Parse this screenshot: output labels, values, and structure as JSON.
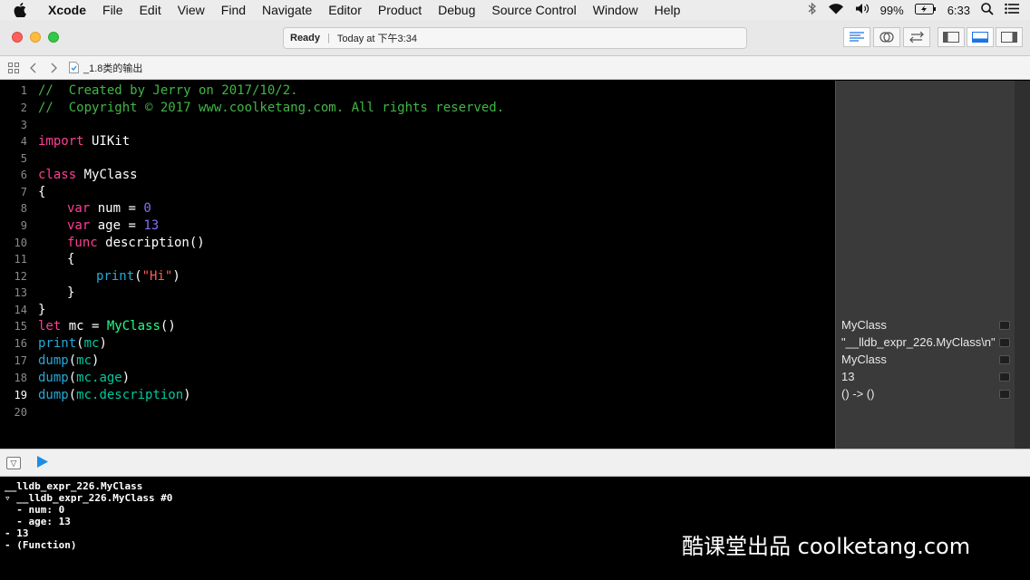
{
  "menubar": {
    "items": [
      "Xcode",
      "File",
      "Edit",
      "View",
      "Find",
      "Navigate",
      "Editor",
      "Product",
      "Debug",
      "Source Control",
      "Window",
      "Help"
    ],
    "battery": "99%",
    "time": "6:33"
  },
  "toolbar": {
    "status": "Ready",
    "timestamp": "Today at 下午3:34"
  },
  "jumpbar": {
    "file": "_1.8类的输出"
  },
  "editor": {
    "line_numbers": [
      "1",
      "2",
      "3",
      "4",
      "5",
      "6",
      "7",
      "8",
      "9",
      "10",
      "11",
      "12",
      "13",
      "14",
      "15",
      "16",
      "17",
      "18",
      "19",
      "20"
    ],
    "current_line": "19",
    "lines": {
      "l1": "//  Created by Jerry on 2017/10/2.",
      "l2": "//  Copyright © 2017 www.coolketang.com. All rights reserved.",
      "l4_kw": "import",
      "l4_rest": " UIKit",
      "l6_kw": "class",
      "l6_rest": " MyClass",
      "l7": "{",
      "l8_kw": "var",
      "l8_mid": " num = ",
      "l8_num": "0",
      "l9_kw": "var",
      "l9_mid": " age = ",
      "l9_num": "13",
      "l10_kw": "func",
      "l10_rest": " description()",
      "l11": "{",
      "l12_fn": "print",
      "l12_open": "(",
      "l12_str": "\"Hi\"",
      "l12_close": ")",
      "l13": "}",
      "l14": "}",
      "l15_kw": "let",
      "l15_mid": " mc = ",
      "l15_ty": "MyClass",
      "l15_rest": "()",
      "l16_fn": "print",
      "l16_open": "(",
      "l16_var": "mc",
      "l16_close": ")",
      "l17_fn": "dump",
      "l17_open": "(",
      "l17_var": "mc",
      "l17_close": ")",
      "l18_fn": "dump",
      "l18_open": "(",
      "l18_var": "mc.age",
      "l18_close": ")",
      "l19_fn": "dump",
      "l19_open": "(",
      "l19_var": "mc.description",
      "l19_close": ")"
    }
  },
  "results": [
    "MyClass",
    "\"__lldb_expr_226.MyClass\\n\"",
    "MyClass",
    "13",
    "() -> ()"
  ],
  "console": [
    "__lldb_expr_226.MyClass",
    "▿ __lldb_expr_226.MyClass #0",
    "  - num: 0",
    "  - age: 13",
    "- 13",
    "- (Function)"
  ],
  "watermark": "酷课堂出品 coolketang.com",
  "colors": {
    "comment": "#41b645",
    "keyword": "#ff3f95",
    "number": "#8a6cf7",
    "string": "#ff5f4f",
    "function": "#27a9d8",
    "type": "#23ff83"
  }
}
